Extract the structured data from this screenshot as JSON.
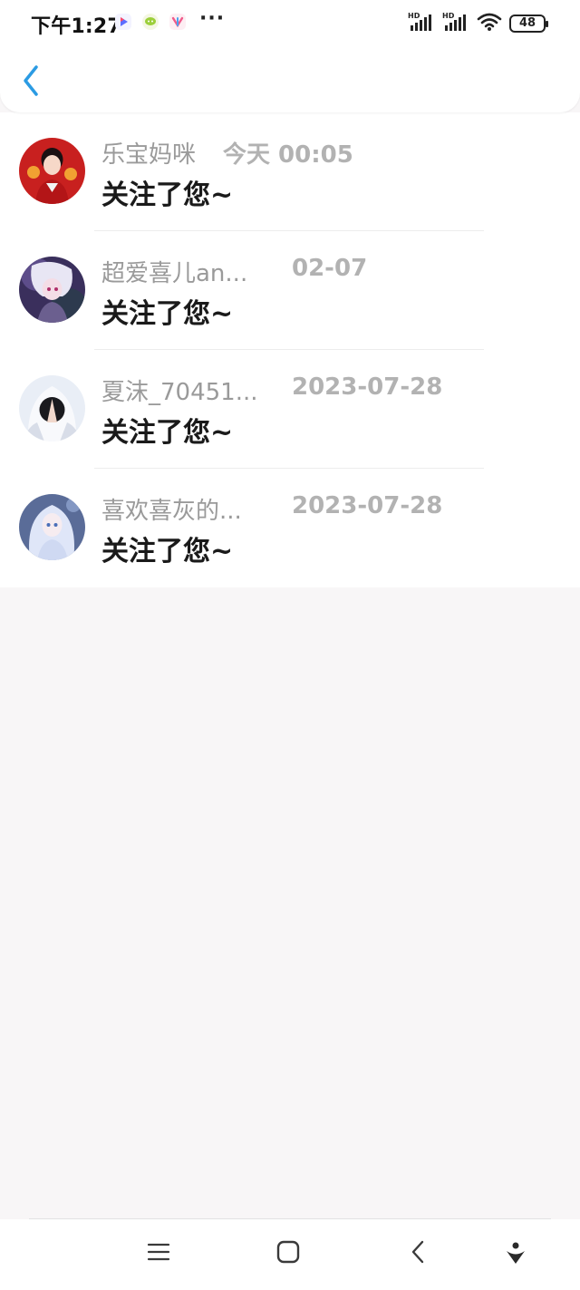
{
  "status_bar": {
    "time": "下午1:27",
    "battery": "48",
    "notification_icons": [
      "video-play-icon",
      "chat-bubble-icon",
      "app-notification-icon"
    ],
    "more": "···"
  },
  "nav": {
    "back_icon": "chevron-left-icon",
    "accent_color": "#2b9be3"
  },
  "followers": [
    {
      "name": "乐宝妈咪",
      "time": "今天 00:05",
      "message": "关注了您~"
    },
    {
      "name": "超爱喜儿an...",
      "time": "02-07",
      "message": "关注了您~"
    },
    {
      "name": "夏沫_70451...",
      "time": "2023-07-28",
      "message": "关注了您~"
    },
    {
      "name": "喜欢喜灰的...",
      "time": "2023-07-28",
      "message": "关注了您~"
    }
  ],
  "system_nav": [
    "menu-icon",
    "home-icon",
    "back-icon",
    "assistant-icon"
  ]
}
